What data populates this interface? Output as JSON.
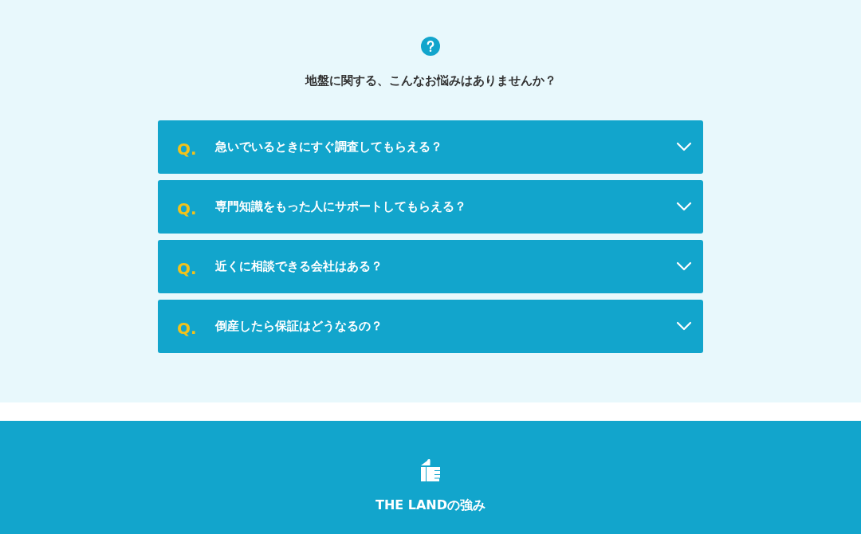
{
  "faq_section": {
    "heading": "地盤に関する、こんなお悩みはありませんか？",
    "items": [
      {
        "marker": "Q.",
        "question": "急いでいるときにすぐ調査してもらえる？",
        "expanded": false
      },
      {
        "marker": "Q.",
        "question": "専門知識をもった人にサポートしてもらえる？",
        "expanded": false
      },
      {
        "marker": "Q.",
        "question": "近くに相談できる会社はある？",
        "expanded": false
      },
      {
        "marker": "Q.",
        "question": "倒産したら保証はどうなるの？",
        "expanded": false
      }
    ]
  },
  "strengths_section": {
    "heading": "THE LANDの強み"
  }
}
